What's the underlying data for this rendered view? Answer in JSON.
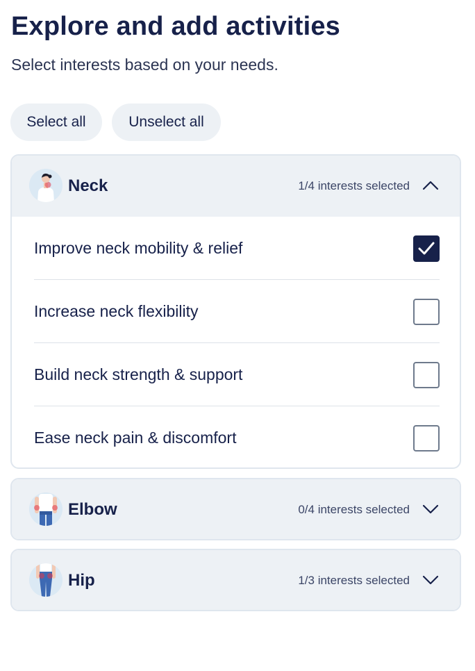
{
  "header": {
    "title": "Explore and add activities",
    "subtitle": "Select interests based on your needs."
  },
  "actions": {
    "select_all": "Select all",
    "unselect_all": "Unselect all"
  },
  "colors": {
    "primary_navy": "#17214a",
    "card_header_bg": "#edf1f5",
    "accent_red": "#e0364a",
    "jeans_blue": "#3d69b3"
  },
  "categories": [
    {
      "name": "Neck",
      "count": "1/4 interests selected",
      "expanded": true,
      "chevron_icon": "chevron-up-icon",
      "options": [
        {
          "label": "Improve neck mobility & relief",
          "checked": true
        },
        {
          "label": "Increase neck flexibility",
          "checked": false
        },
        {
          "label": "Build neck strength & support",
          "checked": false
        },
        {
          "label": "Ease neck pain & discomfort",
          "checked": false
        }
      ]
    },
    {
      "name": "Elbow",
      "count": "0/4 interests selected",
      "expanded": false,
      "chevron_icon": "chevron-down-icon"
    },
    {
      "name": "Hip",
      "count": "1/3 interests selected",
      "expanded": false,
      "chevron_icon": "chevron-down-icon"
    }
  ]
}
